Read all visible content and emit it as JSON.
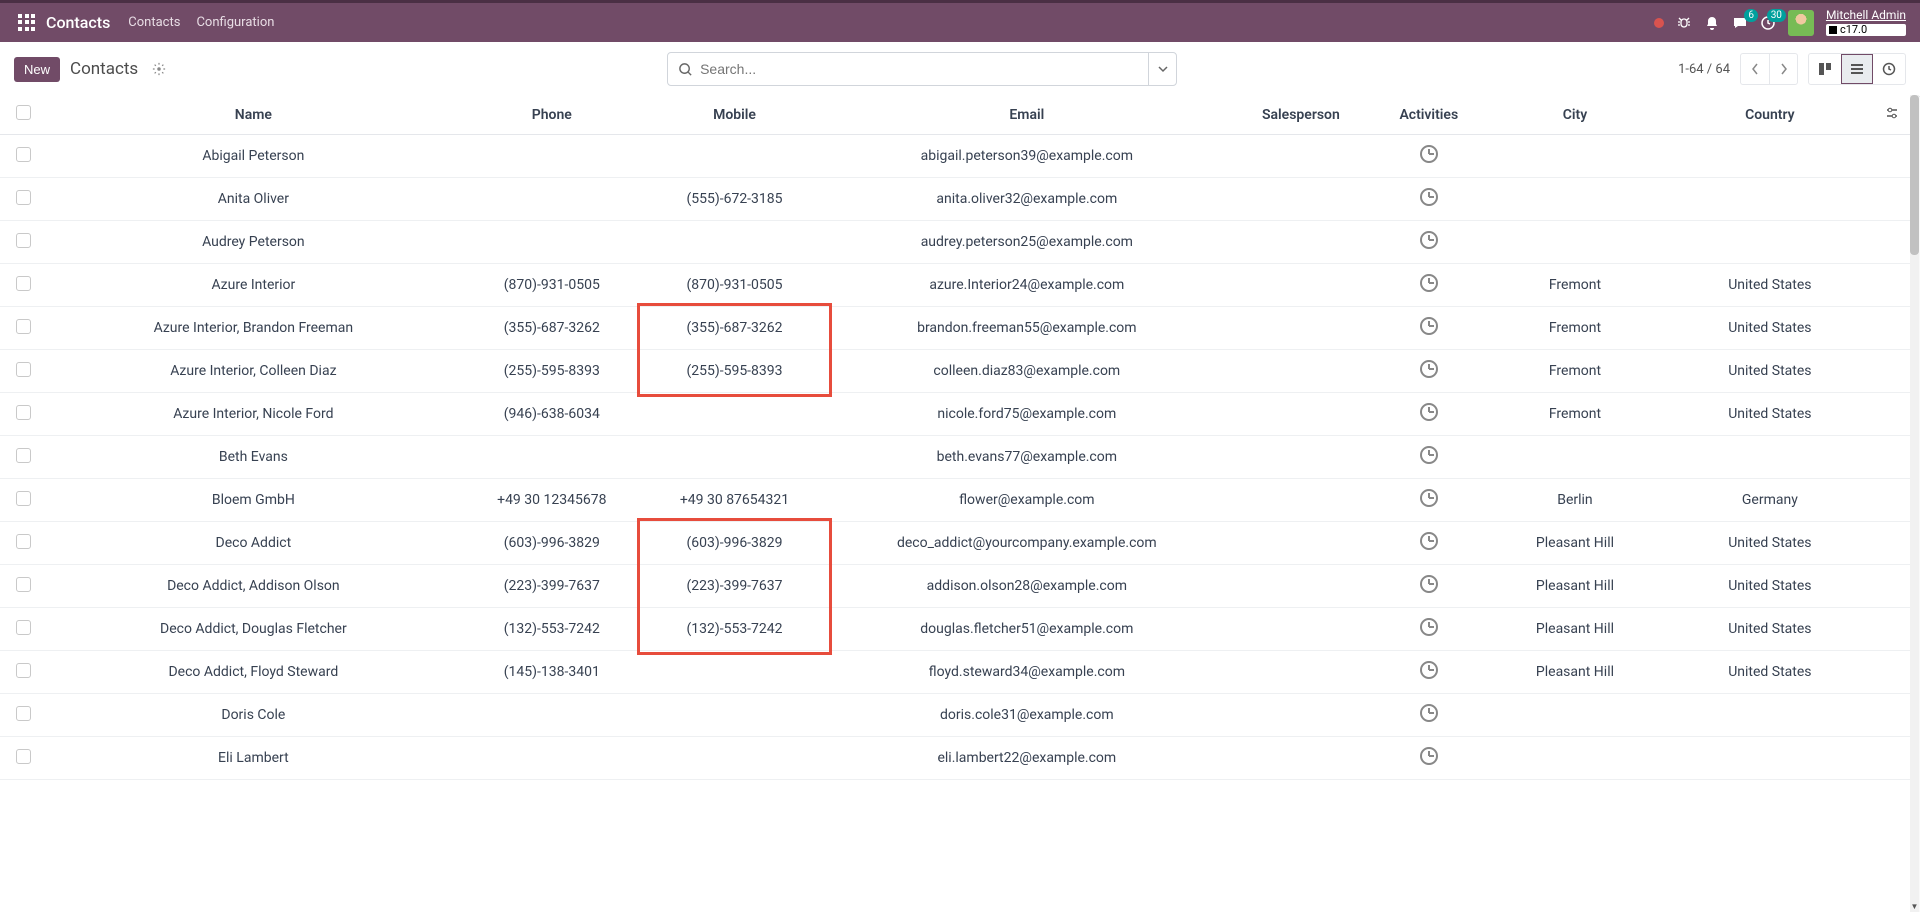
{
  "nav": {
    "brand": "Contacts",
    "items": [
      "Contacts",
      "Configuration"
    ],
    "chat_badge": "6",
    "activity_badge": "30",
    "user": "Mitchell Admin",
    "db": "c17.0"
  },
  "ctrl": {
    "new_btn": "New",
    "breadcrumb": "Contacts",
    "search_placeholder": "Search...",
    "pager": "1-64 / 64"
  },
  "columns": {
    "name": "Name",
    "phone": "Phone",
    "mobile": "Mobile",
    "email": "Email",
    "salesperson": "Salesperson",
    "activities": "Activities",
    "city": "City",
    "country": "Country"
  },
  "rows": [
    {
      "name": "Abigail Peterson",
      "phone": "",
      "mobile": "",
      "email": "abigail.peterson39@example.com",
      "city": "",
      "country": ""
    },
    {
      "name": "Anita Oliver",
      "phone": "",
      "mobile": "(555)-672-3185",
      "email": "anita.oliver32@example.com",
      "city": "",
      "country": ""
    },
    {
      "name": "Audrey Peterson",
      "phone": "",
      "mobile": "",
      "email": "audrey.peterson25@example.com",
      "city": "",
      "country": ""
    },
    {
      "name": "Azure Interior",
      "phone": "(870)-931-0505",
      "mobile": "(870)-931-0505",
      "email": "azure.Interior24@example.com",
      "city": "Fremont",
      "country": "United States"
    },
    {
      "name": "Azure Interior, Brandon Freeman",
      "phone": "(355)-687-3262",
      "mobile": "(355)-687-3262",
      "email": "brandon.freeman55@example.com",
      "city": "Fremont",
      "country": "United States"
    },
    {
      "name": "Azure Interior, Colleen Diaz",
      "phone": "(255)-595-8393",
      "mobile": "(255)-595-8393",
      "email": "colleen.diaz83@example.com",
      "city": "Fremont",
      "country": "United States"
    },
    {
      "name": "Azure Interior, Nicole Ford",
      "phone": "(946)-638-6034",
      "mobile": "",
      "email": "nicole.ford75@example.com",
      "city": "Fremont",
      "country": "United States"
    },
    {
      "name": "Beth Evans",
      "phone": "",
      "mobile": "",
      "email": "beth.evans77@example.com",
      "city": "",
      "country": ""
    },
    {
      "name": "Bloem GmbH",
      "phone": "+49 30 12345678",
      "mobile": "+49 30 87654321",
      "email": "flower@example.com",
      "city": "Berlin",
      "country": "Germany"
    },
    {
      "name": "Deco Addict",
      "phone": "(603)-996-3829",
      "mobile": "(603)-996-3829",
      "email": "deco_addict@yourcompany.example.com",
      "city": "Pleasant Hill",
      "country": "United States"
    },
    {
      "name": "Deco Addict, Addison Olson",
      "phone": "(223)-399-7637",
      "mobile": "(223)-399-7637",
      "email": "addison.olson28@example.com",
      "city": "Pleasant Hill",
      "country": "United States"
    },
    {
      "name": "Deco Addict, Douglas Fletcher",
      "phone": "(132)-553-7242",
      "mobile": "(132)-553-7242",
      "email": "douglas.fletcher51@example.com",
      "city": "Pleasant Hill",
      "country": "United States"
    },
    {
      "name": "Deco Addict, Floyd Steward",
      "phone": "(145)-138-3401",
      "mobile": "",
      "email": "floyd.steward34@example.com",
      "city": "Pleasant Hill",
      "country": "United States"
    },
    {
      "name": "Doris Cole",
      "phone": "",
      "mobile": "",
      "email": "doris.cole31@example.com",
      "city": "",
      "country": ""
    },
    {
      "name": "Eli Lambert",
      "phone": "",
      "mobile": "",
      "email": "eli.lambert22@example.com",
      "city": "",
      "country": ""
    }
  ]
}
